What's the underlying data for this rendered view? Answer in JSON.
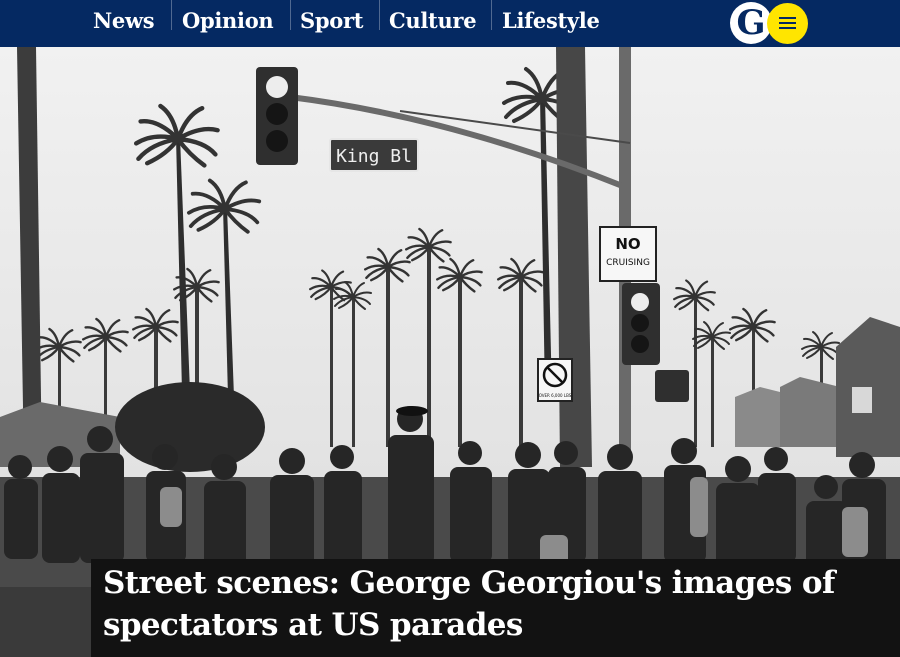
{
  "nav": {
    "items": [
      {
        "label": "News"
      },
      {
        "label": "Opinion"
      },
      {
        "label": "Sport"
      },
      {
        "label": "Culture"
      },
      {
        "label": "Lifestyle"
      }
    ],
    "logo_letter": "G",
    "menu_icon": "hamburger-menu-icon"
  },
  "hero": {
    "street_sign": "King Bl",
    "no_cruising_sign": {
      "line1": "NO",
      "line2": "CRUISING"
    },
    "no_u_turn_sign_caption": "OVER 6,000 LBS"
  },
  "article": {
    "headline": "Street scenes: George Georgiou's images of spectators at US parades"
  },
  "colors": {
    "nav_background": "#052962",
    "menu_button": "#ffe500",
    "headline_background": "#121212"
  }
}
